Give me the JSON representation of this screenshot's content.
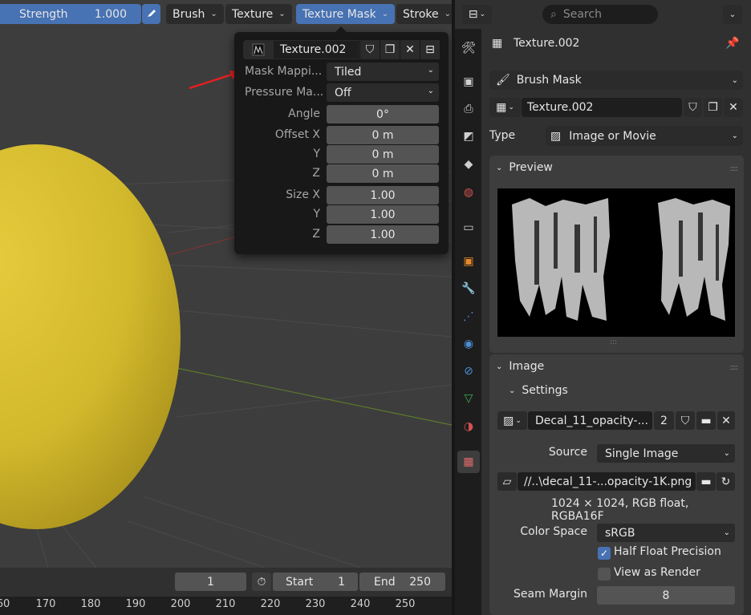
{
  "header": {
    "strength_label": "Strength",
    "strength_value": "1.000",
    "menus": [
      "Brush",
      "Texture",
      "Texture Mask",
      "Stroke"
    ]
  },
  "popover": {
    "texture_name": "Texture.002",
    "mask_mapping_label": "Mask Mappi...",
    "mask_mapping_value": "Tiled",
    "pressure_label": "Pressure Ma...",
    "pressure_value": "Off",
    "angle_label": "Angle",
    "angle_value": "0°",
    "offset_label": "Offset X",
    "offset": [
      "0 m",
      "0 m",
      "0 m"
    ],
    "size_label": "Size X",
    "size": [
      "1.00",
      "1.00",
      "1.00"
    ],
    "y_label": "Y",
    "z_label": "Z"
  },
  "timeline": {
    "current_frame": "1",
    "start_label": "Start",
    "start_value": "1",
    "end_label": "End",
    "end_value": "250",
    "ruler_ticks": [
      "60",
      "170",
      "180",
      "190",
      "200",
      "210",
      "220",
      "230",
      "240",
      "250"
    ]
  },
  "properties": {
    "search_placeholder": "Search",
    "context_title": "Texture.002",
    "brush_mask": "Brush Mask",
    "texture_name": "Texture.002",
    "type_label": "Type",
    "type_value": "Image or Movie",
    "preview_title": "Preview",
    "image_title": "Image",
    "settings_title": "Settings",
    "image_name": "Decal_11_opacity-...",
    "image_users": "2",
    "source_label": "Source",
    "source_value": "Single Image",
    "filepath": "//..\\decal_11-...opacity-1K.png",
    "image_info": "1024 × 1024,  RGB float, RGBA16F",
    "color_space_label": "Color Space",
    "color_space_value": "sRGB",
    "half_float_label": "Half Float Precision",
    "half_float_checked": true,
    "view_render_label": "View as Render",
    "view_render_checked": false,
    "seam_margin_label": "Seam Margin",
    "seam_margin_value": "8"
  },
  "colors": {
    "accent": "#4772b3",
    "sphere": "#d6bd2e",
    "annotation_arrow": "#e02020"
  }
}
